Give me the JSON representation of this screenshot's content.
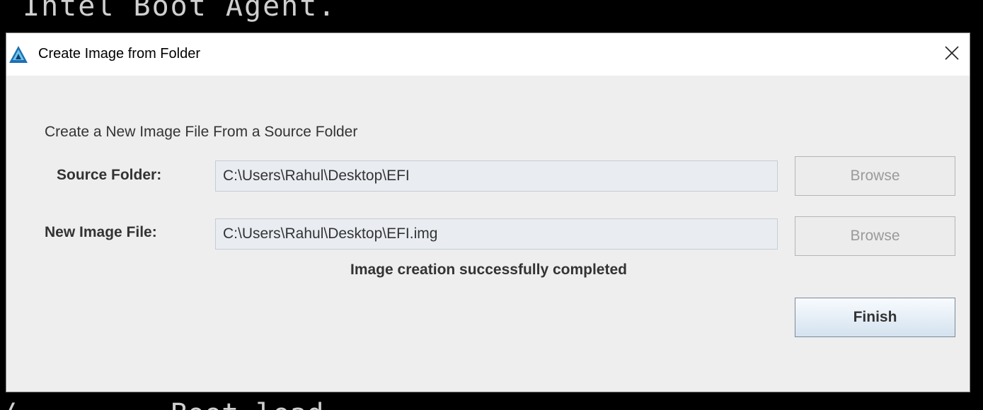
{
  "background": {
    "top_text": "Intel Boot Agent.",
    "bottom_text": "/         Boot load"
  },
  "dialog": {
    "title": "Create Image from Folder",
    "heading": "Create a New Image File From a Source Folder",
    "source_folder": {
      "label": "Source Folder:",
      "value": "C:\\Users\\Rahul\\Desktop\\EFI",
      "browse_label": "Browse"
    },
    "new_image_file": {
      "label": "New Image File:",
      "value": "C:\\Users\\Rahul\\Desktop\\EFI.img",
      "browse_label": "Browse"
    },
    "status": "Image creation successfully completed",
    "finish_label": "Finish"
  },
  "icons": {
    "app": "app-logo-icon",
    "close": "close-icon"
  },
  "colors": {
    "dialog_bg": "#eeeeee",
    "titlebar_bg": "#ffffff",
    "field_bg": "#e9edf2",
    "logo_blue": "#1f6fb5",
    "logo_cyan": "#6cc6e8"
  }
}
